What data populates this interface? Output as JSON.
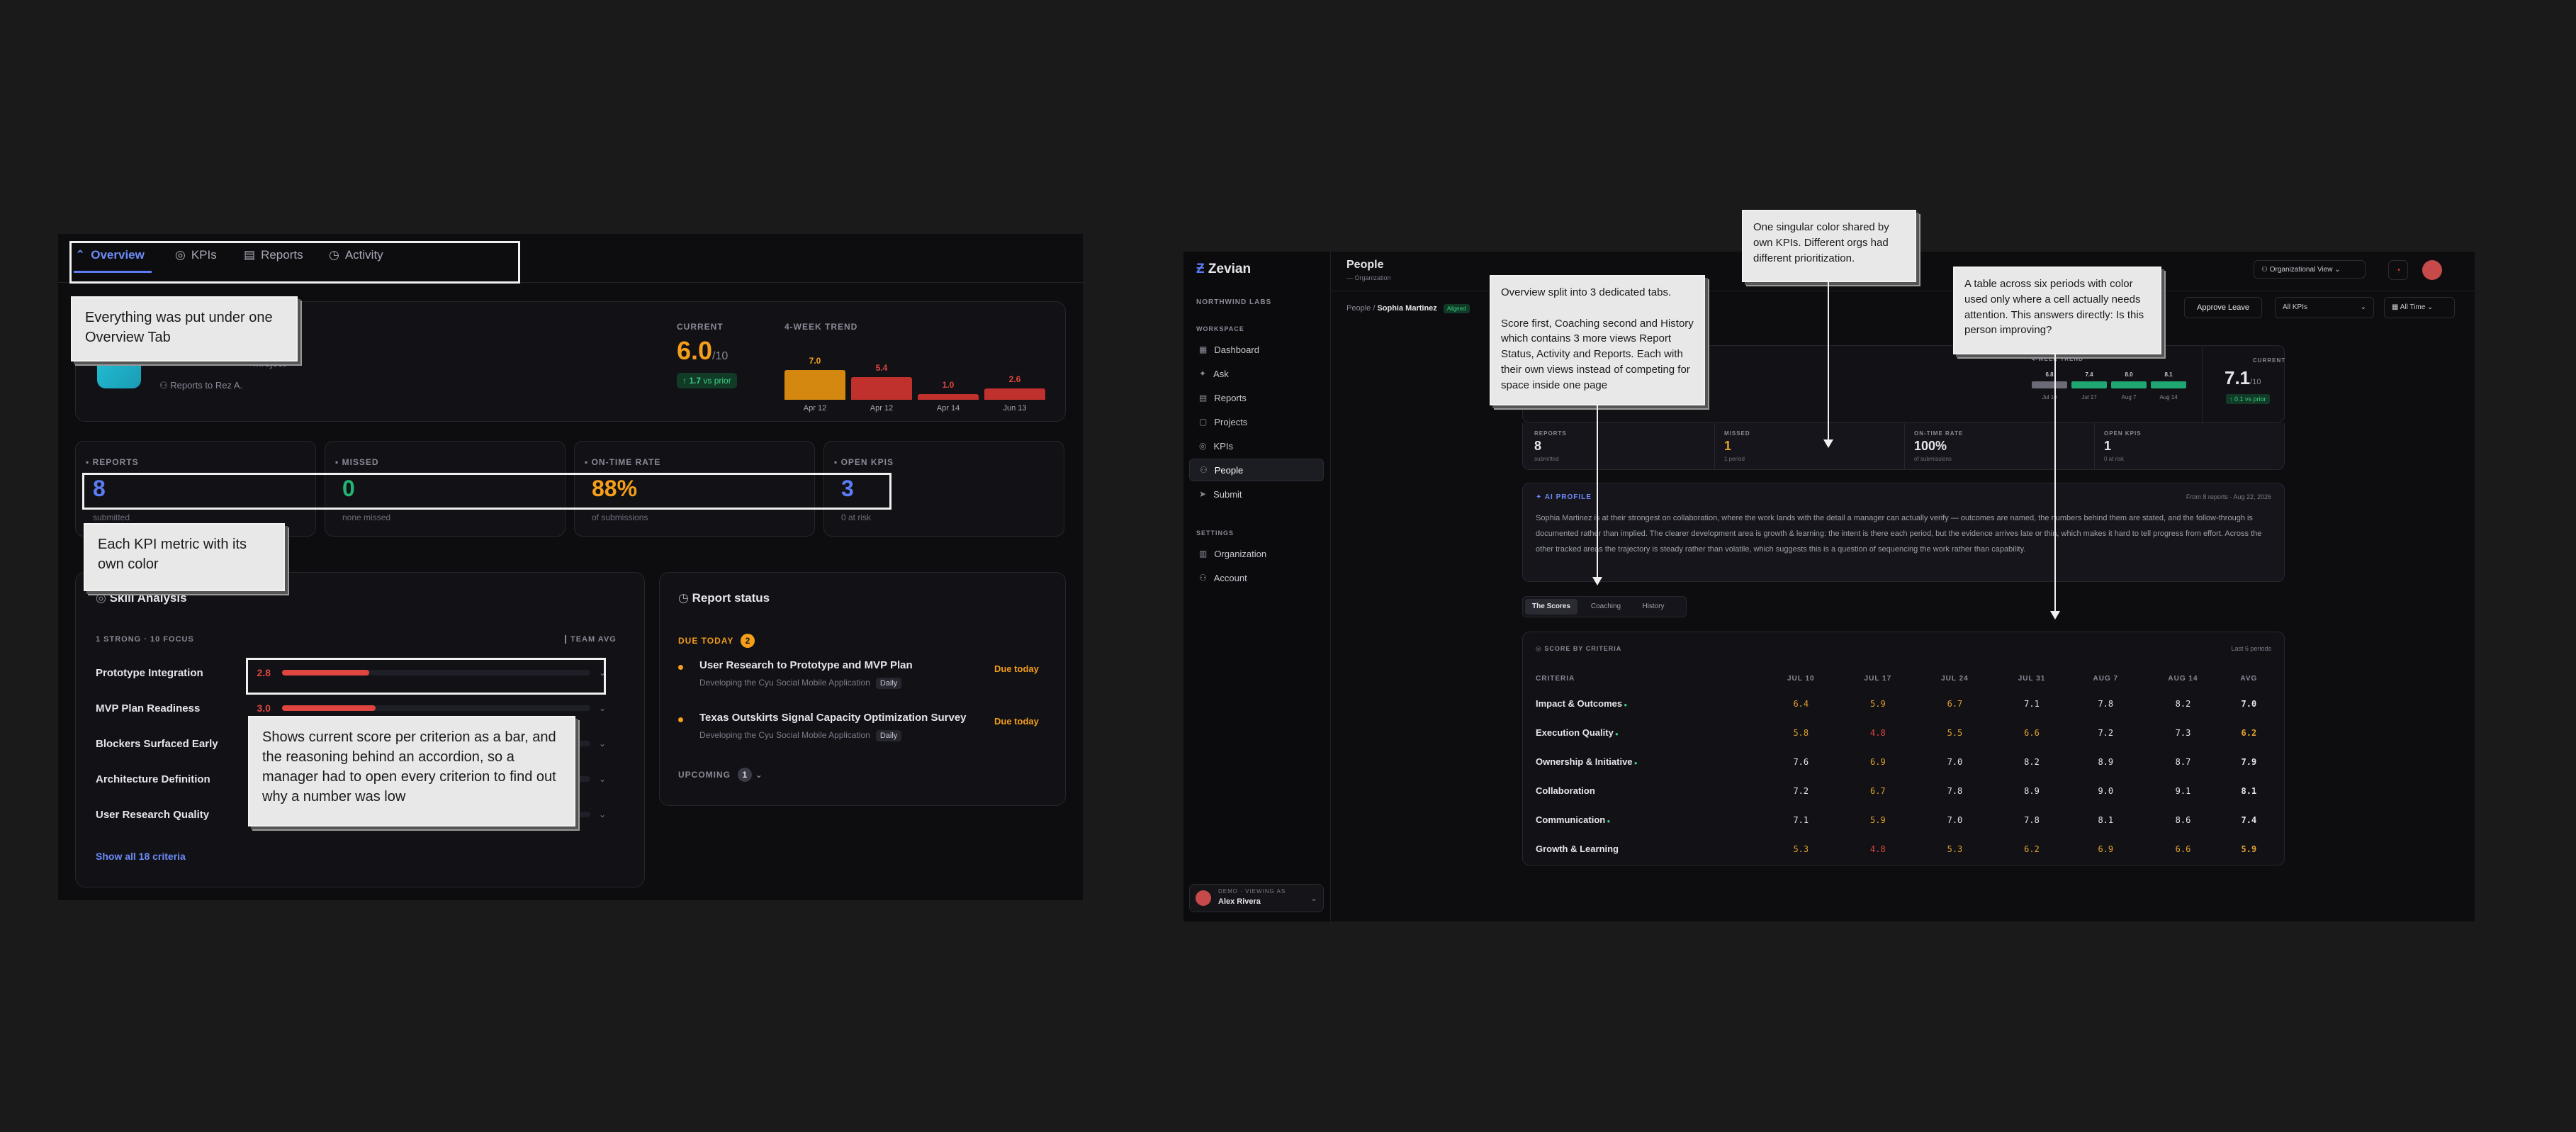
{
  "left": {
    "tabs": [
      {
        "label": "Overview",
        "icon": "chart-up-icon",
        "active": true
      },
      {
        "label": "KPIs",
        "icon": "target-icon"
      },
      {
        "label": "Reports",
        "icon": "document-icon"
      },
      {
        "label": "Activity",
        "icon": "clock-icon"
      }
    ],
    "profile": {
      "project_partial": "...roject",
      "reports_to": "Reports to Rez A."
    },
    "current": {
      "label": "CURRENT",
      "value": "6.0",
      "max": "/10",
      "delta": "↑ 1.7",
      "delta_suffix": "vs prior"
    },
    "trend": {
      "label": "4-WEEK TREND",
      "bars": [
        {
          "value": "7.0",
          "date": "Apr 12",
          "color": "#d4880f",
          "level": 0.7
        },
        {
          "value": "5.4",
          "date": "Apr 12",
          "color": "#c0312e",
          "level": 0.54
        },
        {
          "value": "1.0",
          "date": "Apr 14",
          "color": "#c0312e",
          "level": 0.1
        },
        {
          "value": "2.6",
          "date": "Jun 13",
          "color": "#c0312e",
          "level": 0.26
        }
      ]
    },
    "kpis": [
      {
        "label": "REPORTS",
        "icon": "list-icon",
        "value": "8",
        "sub": "submitted",
        "color": "#5b7cf5"
      },
      {
        "label": "MISSED",
        "icon": "warning-icon",
        "value": "0",
        "sub": "none missed",
        "color": "#22b573"
      },
      {
        "label": "ON-TIME RATE",
        "icon": "check-circle-icon",
        "value": "88%",
        "sub": "of submissions",
        "color": "#f59e1a"
      },
      {
        "label": "OPEN KPIS",
        "icon": "target-icon",
        "value": "3",
        "sub": "0 at risk",
        "color": "#5b7cf5"
      }
    ],
    "skills": {
      "title": "Skill Analysis",
      "summary": "1 STRONG · 10 FOCUS",
      "team_avg": "TEAM AVG",
      "items": [
        {
          "name": "Prototype Integration",
          "score": "2.8",
          "level": 0.28
        },
        {
          "name": "MVP Plan Readiness",
          "score": "3.0",
          "level": 0.3
        },
        {
          "name": "Blockers Surfaced Early",
          "score": "",
          "level": 0
        },
        {
          "name": "Architecture Definition",
          "score": "",
          "level": 0
        },
        {
          "name": "User Research Quality",
          "score": "",
          "level": 0
        }
      ],
      "show_all": "Show all 18 criteria"
    },
    "report_status": {
      "title": "Report status",
      "due_today": "DUE TODAY",
      "due_count": "2",
      "items": [
        {
          "title": "User Research to Prototype and MVP Plan",
          "meta": "Developing the Cyu Social Mobile Application",
          "freq": "Daily",
          "due": "Due today"
        },
        {
          "title": "Texas Outskirts Signal Capacity Optimization Survey",
          "meta": "Developing the Cyu Social Mobile Application",
          "freq": "Daily",
          "due": "Due today"
        }
      ],
      "upcoming": "UPCOMING",
      "upcoming_count": "1"
    }
  },
  "right": {
    "brand": "Zevian",
    "org": "NORTHWIND LABS",
    "workspace_label": "WORKSPACE",
    "nav": [
      "Dashboard",
      "Ask",
      "Reports",
      "Projects",
      "KPIs",
      "People",
      "Submit"
    ],
    "nav_icons": [
      "grid-icon",
      "sparkle-icon",
      "document-icon",
      "folder-icon",
      "target-icon",
      "people-icon",
      "send-icon"
    ],
    "settings_label": "SETTINGS",
    "settings_nav": [
      "Organization",
      "Account"
    ],
    "settings_icons": [
      "building-icon",
      "user-icon"
    ],
    "user": {
      "caption": "DEMO · VIEWING AS",
      "name": "Alex Rivera"
    },
    "header": {
      "title": "People",
      "subtitle": "— Organization",
      "view_select": "Organizational View"
    },
    "breadcrumb": {
      "root": "People",
      "name": "Sophia Martinez",
      "badge": "Aligned"
    },
    "toolbar": {
      "approve": "Approve Leave",
      "kpi_select": "All KPIs",
      "time_select": "All Time"
    },
    "profile_partial": "e",
    "trend": {
      "label": "4-WEEK TREND",
      "values": [
        "6.8",
        "7.4",
        "8.0",
        "8.1"
      ],
      "dates": [
        "Jul 10",
        "Jul 17",
        "Aug 7",
        "Aug 14"
      ]
    },
    "current": {
      "label": "CURRENT",
      "value": "7.1",
      "max": "/10",
      "delta": "↑ 0.1 vs prior"
    },
    "kpis": [
      {
        "label": "REPORTS",
        "value": "8",
        "sub": "submitted",
        "color": "#e6e6ea"
      },
      {
        "label": "MISSED",
        "value": "1",
        "sub": "1 period",
        "color": "#e0a030"
      },
      {
        "label": "ON-TIME RATE",
        "value": "100%",
        "sub": "of submissions",
        "color": "#e6e6ea"
      },
      {
        "label": "OPEN KPIS",
        "value": "1",
        "sub": "0 at risk",
        "color": "#e6e6ea"
      }
    ],
    "ai_profile": {
      "label": "AI PROFILE",
      "meta": "From 8 reports · Aug 22, 2026",
      "text": "Sophia Martinez is at their strongest on collaboration, where the work lands with the detail a manager can actually verify — outcomes are named, the numbers behind them are stated, and the follow-through is documented rather than implied. The clearer development area is growth & learning: the intent is there each period, but the evidence arrives late or thin, which makes it hard to tell progress from effort. Across the other tracked areas the trajectory is steady rather than volatile, which suggests this is a question of sequencing the work rather than capability."
    },
    "tabs": [
      "The Scores",
      "Coaching",
      "History"
    ],
    "scores": {
      "label": "SCORE BY CRITERIA",
      "meta": "Last 6 periods",
      "columns": [
        "CRITERIA",
        "JUL 10",
        "JUL 17",
        "JUL 24",
        "JUL 31",
        "AUG 7",
        "AUG 14",
        "AVG"
      ],
      "rows": [
        {
          "name": "Impact & Outcomes",
          "dot": true,
          "values": [
            "6.4",
            "5.9",
            "6.7",
            "7.1",
            "7.8",
            "8.2",
            "7.0"
          ]
        },
        {
          "name": "Execution Quality",
          "dot": true,
          "values": [
            "5.8",
            "4.8",
            "5.5",
            "6.6",
            "7.2",
            "7.3",
            "6.2"
          ]
        },
        {
          "name": "Ownership & Initiative",
          "dot": true,
          "values": [
            "7.6",
            "6.9",
            "7.0",
            "8.2",
            "8.9",
            "8.7",
            "7.9"
          ]
        },
        {
          "name": "Collaboration",
          "dot": false,
          "values": [
            "7.2",
            "6.7",
            "7.8",
            "8.9",
            "9.0",
            "9.1",
            "8.1"
          ]
        },
        {
          "name": "Communication",
          "dot": true,
          "values": [
            "7.1",
            "5.9",
            "7.0",
            "7.8",
            "8.1",
            "8.6",
            "7.4"
          ]
        },
        {
          "name": "Growth & Learning",
          "dot": false,
          "values": [
            "5.3",
            "4.8",
            "5.3",
            "6.2",
            "6.9",
            "6.6",
            "5.9"
          ]
        }
      ]
    }
  },
  "notes": {
    "overview_tab": "Everything was put under one Overview Tab",
    "kpi_color": "Each KPI metric with its own color",
    "skill_bar": "Shows current score per criterion as a bar, and the reasoning behind an accordion, so a manager had to open every criterion to find out why a number was low",
    "tabs_split": "Overview split into 3 dedicated tabs.\n\nScore first, Coaching second and History which contains 3 more views Report Status, Activity and Reports. Each with their own views instead of competing for space inside one page",
    "single_color": "One singular color shared by own KPIs. Different orgs had different prioritization.",
    "table_six": "A table across six periods with color used only where a cell actually needs attention. This answers directly: Is this person improving?"
  }
}
